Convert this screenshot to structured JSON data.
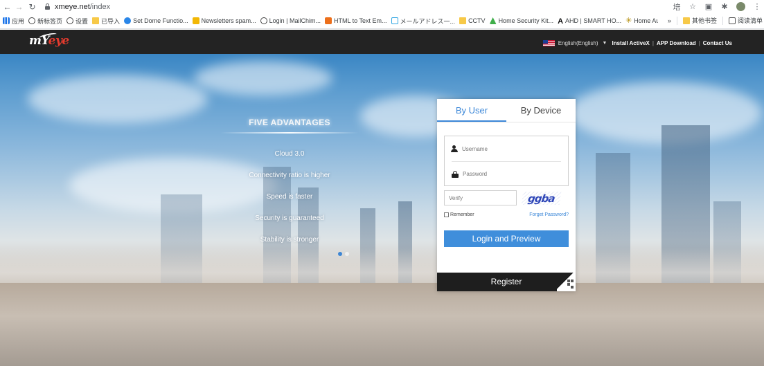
{
  "browser": {
    "url_host": "xmeye.net",
    "url_path": "/index",
    "bookmarks": [
      {
        "label": "应用",
        "icon": "apps-grid-icon"
      },
      {
        "label": "新标签页",
        "icon": "globe-icon"
      },
      {
        "label": "设置",
        "icon": "globe-icon"
      },
      {
        "label": "已导入",
        "icon": "folder-icon"
      },
      {
        "label": "Set Dome Functio...",
        "icon": "blue-circle-icon"
      },
      {
        "label": "Newsletters spam...",
        "icon": "yellow-leaf-icon"
      },
      {
        "label": "Login | MailChim...",
        "icon": "globe-icon"
      },
      {
        "label": "HTML to Text Em...",
        "icon": "orange-icon"
      },
      {
        "label": "メールアドレス一...",
        "icon": "gmail-icon"
      },
      {
        "label": "CCTV",
        "icon": "folder-icon"
      },
      {
        "label": "Home Security Kit...",
        "icon": "green-triangle-icon"
      },
      {
        "label": "AHD | SMART HO...",
        "icon": "letter-a-icon"
      },
      {
        "label": "Home Automatio...",
        "icon": "star-icon"
      }
    ],
    "bookmarks_right": [
      {
        "label": "»"
      },
      {
        "label": "其他书签",
        "icon": "folder-icon"
      },
      {
        "label": "阅读清单",
        "icon": "reading-list-icon"
      }
    ]
  },
  "header": {
    "logo_main": "mY",
    "logo_accent": "eye",
    "language": "English(English)",
    "links": [
      "Install ActiveX",
      "APP Download",
      "Contact Us"
    ]
  },
  "advantages": {
    "title": "FIVE ADVANTAGES",
    "items": [
      "Cloud 3.0",
      "Connectivity ratio is higher",
      "Speed is faster",
      "Security is guaranteed",
      "Stability is stronger"
    ]
  },
  "login": {
    "tabs": [
      "By User",
      "By Device"
    ],
    "active_tab": 0,
    "username_placeholder": "Username",
    "password_placeholder": "Password",
    "verify_placeholder": "Verify",
    "captcha_text": "ggba",
    "remember_label": "Remember",
    "forget_label": "Forget Password?",
    "login_button": "Login and Preview",
    "register_button": "Register"
  },
  "colors": {
    "accent": "#3b87d8",
    "header_bg": "#232323",
    "register_bg": "#1e1e1e"
  }
}
